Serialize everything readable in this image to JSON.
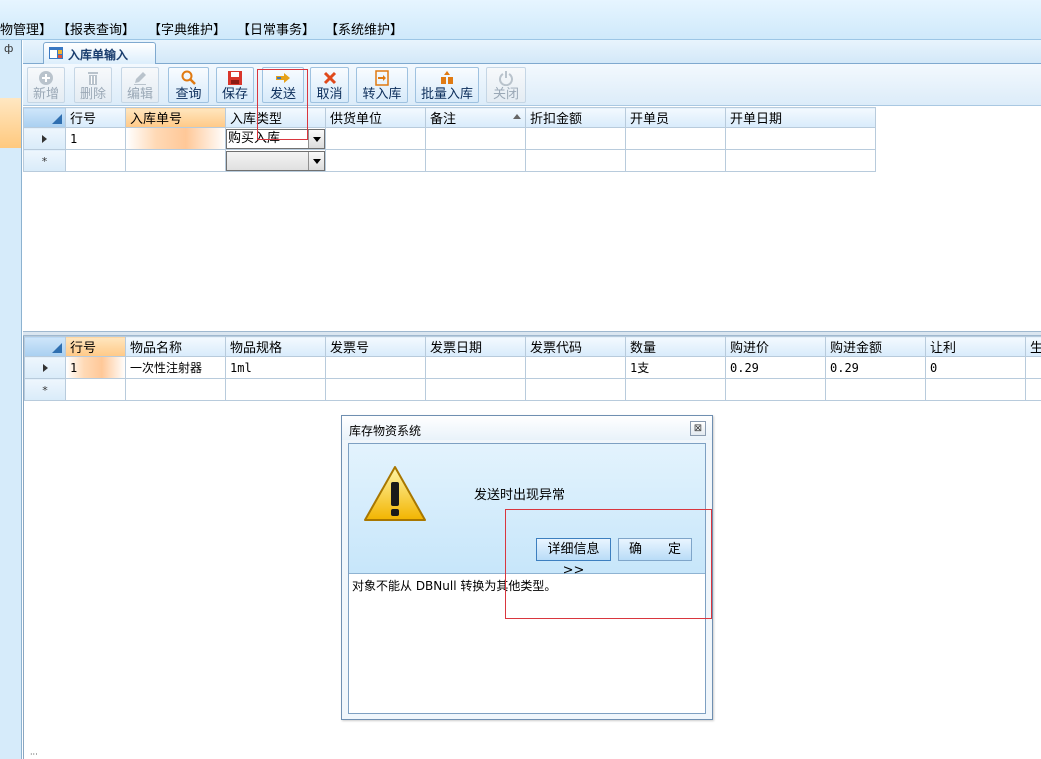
{
  "menu": {
    "items": [
      "物管理】",
      "【报表查询】",
      "【字典维护】",
      "【日常事务】",
      "【系统维护】"
    ]
  },
  "left_panel": {
    "pin": "ф"
  },
  "tab": {
    "label": "入库单输入",
    "icon": "form-icon"
  },
  "toolbar": {
    "buttons": [
      {
        "label": "新增",
        "icon": "add-icon",
        "enabled": false
      },
      {
        "label": "删除",
        "icon": "trash-icon",
        "enabled": false
      },
      {
        "label": "编辑",
        "icon": "pencil-icon",
        "enabled": false
      },
      {
        "label": "查询",
        "icon": "search-icon",
        "enabled": true
      },
      {
        "label": "保存",
        "icon": "save-icon",
        "enabled": true
      },
      {
        "label": "发送",
        "icon": "send-icon",
        "enabled": true
      },
      {
        "label": "取消",
        "icon": "cancel-icon",
        "enabled": true
      },
      {
        "label": "转入库",
        "icon": "transfer-icon",
        "enabled": true
      },
      {
        "label": "批量入库",
        "icon": "batch-icon",
        "enabled": true
      },
      {
        "label": "关闭",
        "icon": "power-icon",
        "enabled": false
      }
    ]
  },
  "grid1": {
    "columns": [
      "行号",
      "入库单号",
      "入库类型",
      "供货单位",
      "备注",
      "折扣金额",
      "开单员",
      "开单日期"
    ],
    "rows": [
      {
        "row_no": "1",
        "order_no": "",
        "type": "购买入库",
        "supplier": "",
        "note": "",
        "discount": "",
        "clerk": "",
        "date": ""
      }
    ]
  },
  "grid2": {
    "columns": [
      "行号",
      "物品名称",
      "物品规格",
      "发票号",
      "发票日期",
      "发票代码",
      "数量",
      "购进价",
      "购进金额",
      "让利",
      "生"
    ],
    "rows": [
      {
        "row_no": "1",
        "name": "一次性注射器",
        "spec": "1ml",
        "invoice_no": "",
        "invoice_date": "",
        "invoice_code": "",
        "qty": "1支",
        "price": "0.29",
        "amount": "0.29",
        "rebate": "0",
        "extra": ""
      }
    ]
  },
  "dialog": {
    "title": "库存物资系统",
    "close": "⊠",
    "message": "发送时出现异常",
    "details_button": "详细信息>>",
    "ok_button": "确　　定",
    "detail_text": "对象不能从 DBNull 转换为其他类型。",
    "icon": "warning-icon"
  },
  "status": {
    "text": "···"
  },
  "colors": {
    "annotation": "#d9363e",
    "accent": "#2f6fb0",
    "highlight": "#ffc987"
  }
}
